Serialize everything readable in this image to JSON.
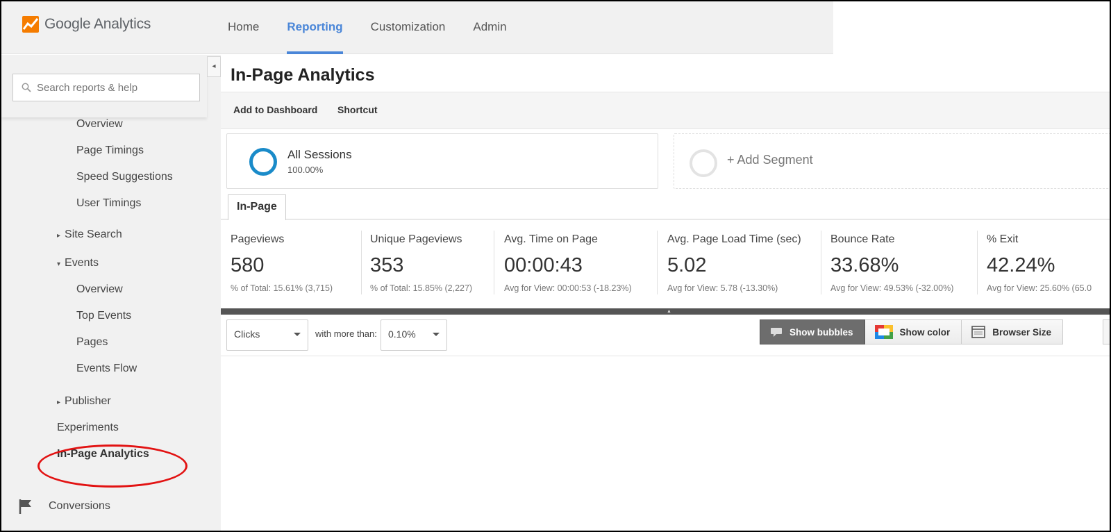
{
  "app": {
    "logo_text": "Google Analytics",
    "accent_color": "#4a86d8",
    "logo_color": "#f57c00"
  },
  "nav": {
    "items": [
      {
        "label": "Home",
        "active": false
      },
      {
        "label": "Reporting",
        "active": true
      },
      {
        "label": "Customization",
        "active": false
      },
      {
        "label": "Admin",
        "active": false
      }
    ]
  },
  "sidebar": {
    "collapse_icon": "triangle-left-icon",
    "search_placeholder": "Search reports & help",
    "items": [
      {
        "label": "Overview"
      },
      {
        "label": "Page Timings"
      },
      {
        "label": "Speed Suggestions"
      },
      {
        "label": "User Timings"
      },
      {
        "label": "Site Search",
        "caret": "▸"
      },
      {
        "label": "Events",
        "caret": "▾"
      },
      {
        "label": "Overview"
      },
      {
        "label": "Top Events"
      },
      {
        "label": "Pages"
      },
      {
        "label": "Events Flow"
      },
      {
        "label": "Publisher",
        "caret": "▸"
      },
      {
        "label": "Experiments"
      },
      {
        "label": "In-Page Analytics",
        "selected": true
      }
    ],
    "conversions_label": "Conversions",
    "highlight_color": "#e21212"
  },
  "main": {
    "title": "In-Page Analytics",
    "toolbar": {
      "add_to_dashboard": "Add to Dashboard",
      "shortcut": "Shortcut"
    },
    "segments": {
      "all_sessions_title": "All Sessions",
      "all_sessions_pct": "100.00%",
      "all_sessions_color": "#1a8bc9",
      "add_segment": "+ Add Segment"
    },
    "tab_label": "In-Page",
    "metrics": [
      {
        "label": "Pageviews",
        "value": "580",
        "sub": "% of Total: 15.61% (3,715)"
      },
      {
        "label": "Unique Pageviews",
        "value": "353",
        "sub": "% of Total: 15.85% (2,227)"
      },
      {
        "label": "Avg. Time on Page",
        "value": "00:00:43",
        "sub": "Avg for View: 00:00:53 (-18.23%)"
      },
      {
        "label": "Avg. Page Load Time (sec)",
        "value": "5.02",
        "sub": "Avg for View: 5.78 (-13.30%)"
      },
      {
        "label": "Bounce Rate",
        "value": "33.68%",
        "sub": "Avg for View: 49.53% (-32.00%)"
      },
      {
        "label": "% Exit",
        "value": "42.24%",
        "sub": "Avg for View: 25.60% (65.0"
      }
    ],
    "controls": {
      "metric_select": "Clicks",
      "more_than_label": "with more than:",
      "threshold_select": "0.10%",
      "show_bubbles": "Show bubbles",
      "show_color": "Show color",
      "browser_size": "Browser Size"
    }
  }
}
